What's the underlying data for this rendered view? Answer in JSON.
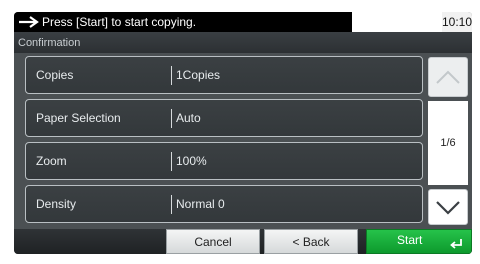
{
  "status": {
    "message": "Press [Start] to start copying.",
    "time": "10:10"
  },
  "title": "Confirmation",
  "settings": [
    {
      "label": "Copies",
      "value": "1Copies"
    },
    {
      "label": "Paper Selection",
      "value": "Auto"
    },
    {
      "label": "Zoom",
      "value": "100%"
    },
    {
      "label": "Density",
      "value": "Normal 0"
    }
  ],
  "pagination": {
    "indicator": "1/6"
  },
  "buttons": {
    "cancel": "Cancel",
    "back": "< Back",
    "start": "Start"
  },
  "colors": {
    "start_green": "#19b23c",
    "panel_gray": "#4a4f52"
  },
  "icons": {
    "status": "right-arrow-icon",
    "scroll_up": "chevron-up-icon",
    "scroll_down": "chevron-down-icon",
    "start": "enter-icon"
  }
}
